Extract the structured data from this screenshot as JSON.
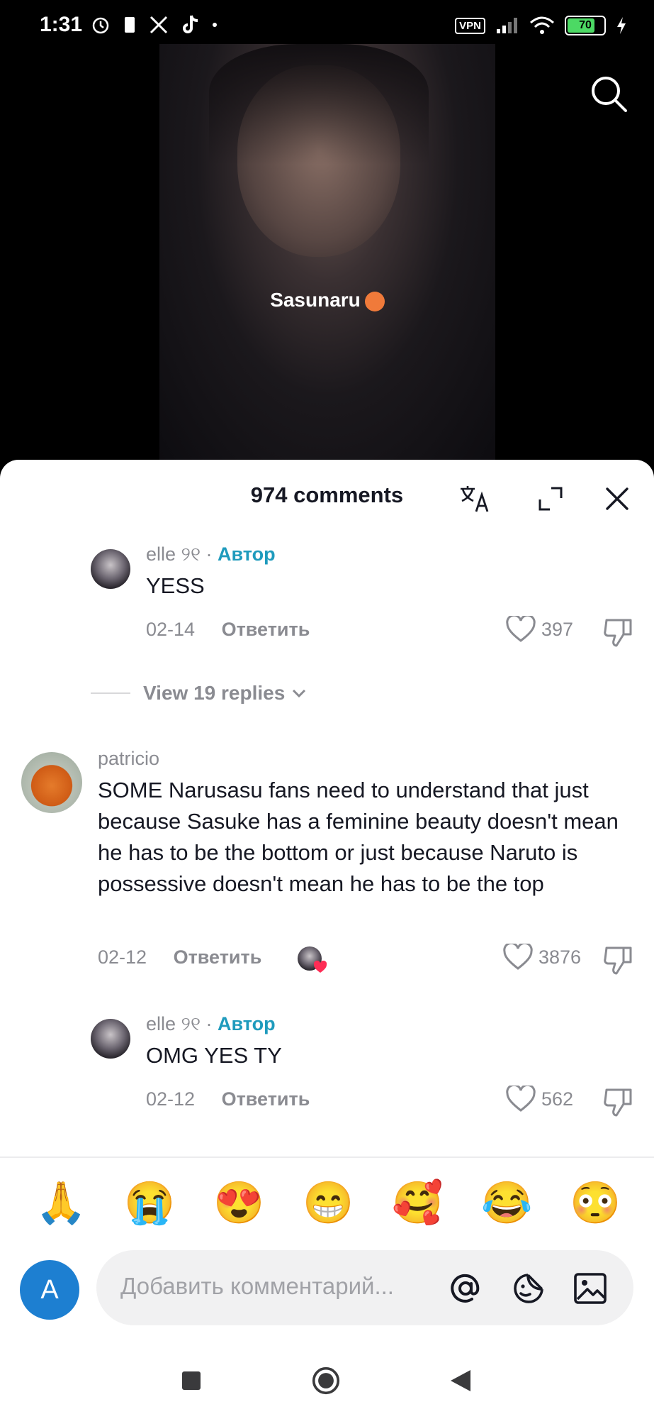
{
  "status_bar": {
    "time": "1:31",
    "vpn": "VPN",
    "battery": "70",
    "battery_level": 0.7
  },
  "video": {
    "overlay_text": "Sasunaru"
  },
  "comments_sheet": {
    "title": "974 comments",
    "comments": [
      {
        "username": "elle ୨୧",
        "author_badge": "Автор",
        "text": "YESS",
        "date": "02-14",
        "reply_label": "Ответить",
        "likes": "397"
      },
      {
        "view_replies": "View 19 replies"
      },
      {
        "username": "patricio",
        "text": "SOME Narusasu fans need to understand that just because Sasuke has a feminine beauty doesn't mean he has to be the bottom or just because Naruto is possessive doesn't mean he has to be the top",
        "date": "02-12",
        "reply_label": "Ответить",
        "likes": "3876"
      },
      {
        "username": "elle ୨୧",
        "author_badge": "Автор",
        "text": "OMG YES TY",
        "date": "02-12",
        "reply_label": "Ответить",
        "likes": "562"
      }
    ]
  },
  "emoji_bar": [
    "🙏",
    "😭",
    "😍",
    "😁",
    "🥰",
    "😂",
    "😳"
  ],
  "input": {
    "avatar_letter": "A",
    "placeholder": "Добавить комментарий..."
  }
}
